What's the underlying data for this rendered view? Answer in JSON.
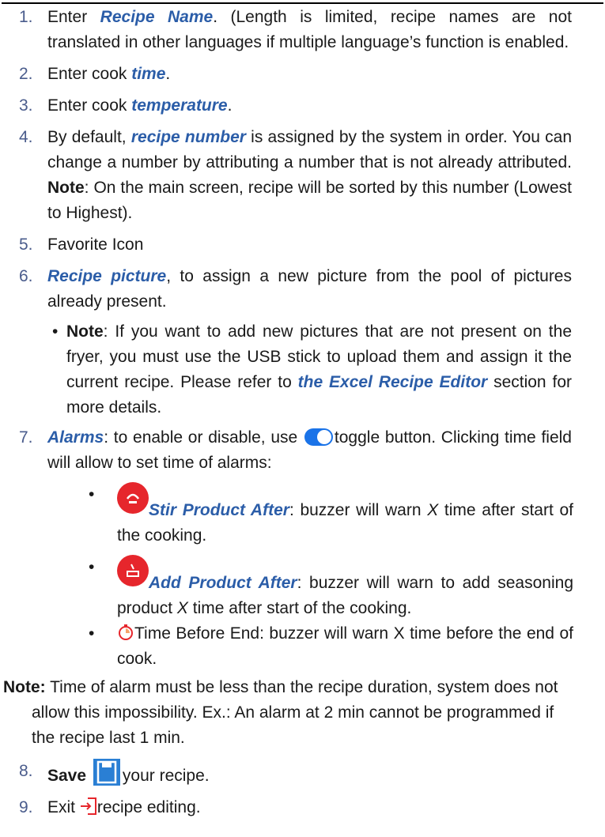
{
  "items": [
    {
      "n": "1.",
      "parts": {
        "a": "Enter ",
        "b": "Recipe Name",
        "c": ". (Length is limited, recipe names are not translated in other languages if multiple language’s function is enabled."
      }
    },
    {
      "n": "2.",
      "parts": {
        "a": "Enter cook ",
        "b": "time",
        "c": "."
      }
    },
    {
      "n": "3.",
      "parts": {
        "a": "Enter cook ",
        "b": "temperature",
        "c": "."
      }
    },
    {
      "n": "4.",
      "parts": {
        "a": "By default, ",
        "b": "recipe number",
        "c": " is assigned by the system in order. You can change a number by attributing a number that is not already attributed. ",
        "d": "Note",
        "e": ": On the main screen, recipe will be sorted by this number (Lowest to Highest)."
      }
    },
    {
      "n": "5.",
      "parts": {
        "a": "Favorite Icon"
      }
    },
    {
      "n": "6.",
      "parts": {
        "b": "Recipe picture",
        "c": ", to assign a new picture from the pool of pictures already present."
      }
    },
    {
      "n": "7.",
      "parts": {
        "b": "Alarms",
        "c": ": to enable or disable, use ",
        "d": "toggle button.  Clicking time field will allow to set time of alarms:"
      }
    },
    {
      "n": "8.",
      "parts": {
        "a": "Save",
        "b": "your recipe."
      }
    },
    {
      "n": "9.",
      "parts": {
        "a": "Exit ",
        "b": "recipe editing."
      }
    }
  ],
  "sub_note": {
    "a": "Note",
    "b": ": If you want to add new pictures that are not present on the fryer, you must use the USB stick to upload them and assign it the current recipe.  Please refer to ",
    "c": "the Excel Recipe Editor",
    "d": " section for more details."
  },
  "alarms": [
    {
      "name": "Stir Product After",
      "text1": ": buzzer will warn ",
      "x": "X",
      "text2": " time after start of the cooking."
    },
    {
      "name": "Add Product After",
      "text1": ": buzzer will warn to add seasoning product ",
      "x": "X",
      "text2": " time after start of the cooking."
    },
    {
      "text": "Time Before End: buzzer will warn X time before the end of cook."
    }
  ],
  "note": {
    "label": "Note:",
    "text": " Time of alarm must be less than the recipe duration, system does not allow this impossibility. Ex.: An alarm at 2 min cannot be programmed if the recipe last 1 min."
  },
  "colors": {
    "accent_blue": "#2b5da8",
    "toggle_blue": "#1a73e8",
    "alarm_red": "#e6262c",
    "save_blue": "#2a7fd4"
  },
  "icons": {
    "toggle": "toggle-icon",
    "stir": "stir-icon",
    "add": "add-product-icon",
    "timer": "timer-icon",
    "save": "save-icon",
    "exit": "exit-icon"
  }
}
